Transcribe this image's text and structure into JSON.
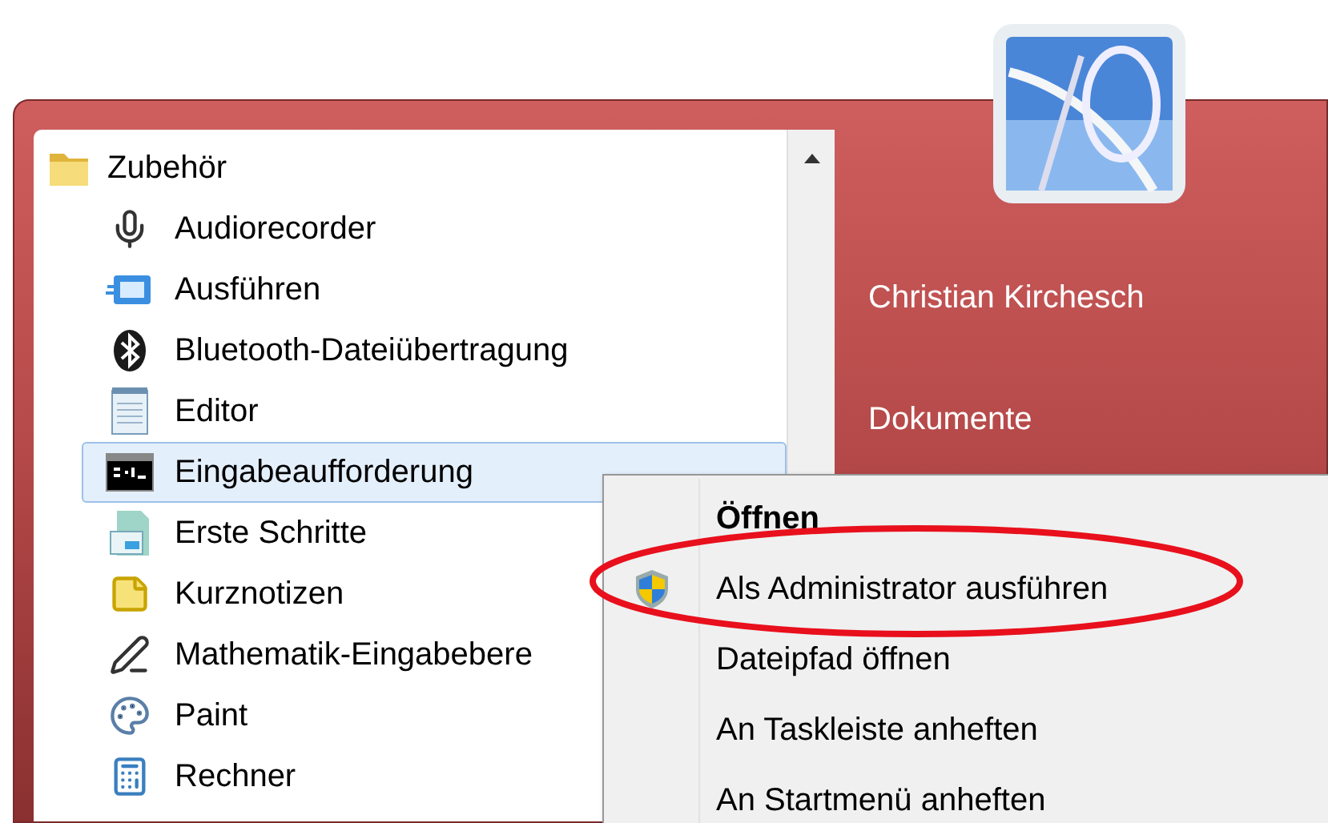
{
  "programs": {
    "folder": {
      "label": "Zubehör"
    },
    "items": [
      {
        "label": "Audiorecorder",
        "kind": "mic",
        "selected": false
      },
      {
        "label": "Ausführen",
        "kind": "run",
        "selected": false
      },
      {
        "label": "Bluetooth-Dateiübertragung",
        "kind": "bluetooth",
        "selected": false
      },
      {
        "label": "Editor",
        "kind": "notepad",
        "selected": false
      },
      {
        "label": "Eingabeaufforderung",
        "kind": "console",
        "selected": true
      },
      {
        "label": "Erste Schritte",
        "kind": "start",
        "selected": false
      },
      {
        "label": "Kurznotizen",
        "kind": "notes",
        "selected": false
      },
      {
        "label": "Mathematik-Eingabebere",
        "kind": "math",
        "selected": false
      },
      {
        "label": "Paint",
        "kind": "paint",
        "selected": false
      },
      {
        "label": "Rechner",
        "kind": "calc",
        "selected": false
      }
    ]
  },
  "user": {
    "name": "Christian Kirchesch"
  },
  "places": [
    {
      "label": "Dokumente"
    }
  ],
  "context_menu": {
    "items": [
      {
        "label": "Öffnen",
        "kind": "plain",
        "default": true
      },
      {
        "label": "Als Administrator ausführen",
        "kind": "shield",
        "default": false
      },
      {
        "label": "Dateipfad öffnen",
        "kind": "plain",
        "default": false
      },
      {
        "label": "An Taskleiste anheften",
        "kind": "plain",
        "default": false
      },
      {
        "label": "An Startmenü anheften",
        "kind": "plain",
        "default": false
      }
    ]
  }
}
